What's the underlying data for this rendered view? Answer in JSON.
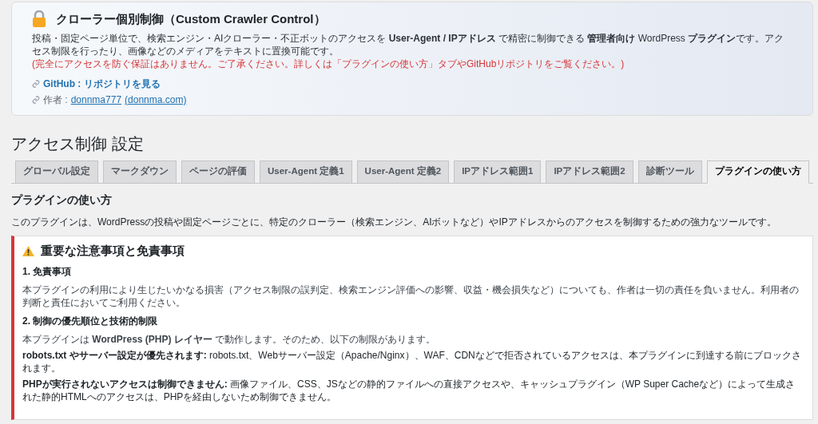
{
  "header": {
    "title": "クローラー個別制御（Custom Crawler Control）",
    "description": "投稿・固定ページ単位で、検索エンジン・AIクローラー・不正ボットのアクセスを **User-Agent / IPアドレス** で精密に制御できる **管理者向け** WordPress **プラグイン**です。アクセス制限を行ったり、画像などのメディアをテキストに置換可能です。",
    "warning": "(完全にアクセスを防ぐ保証はありません。ご了承ください。詳しくは「プラグインの使い方」タブやGitHubリポジトリをご覧ください。)",
    "github_link": "GitHub : リポジトリを見る",
    "author_label": "作者 :",
    "author_link": "donnma777",
    "author_site": "(donnma.com)"
  },
  "page_title": "アクセス制御 設定",
  "tabs": [
    {
      "label": "グローバル設定",
      "selected": false
    },
    {
      "label": "マークダウン",
      "selected": false
    },
    {
      "label": "ページの評価",
      "selected": false
    },
    {
      "label": "User-Agent 定義1",
      "selected": false
    },
    {
      "label": "User-Agent 定義2",
      "selected": false
    },
    {
      "label": "IPアドレス範囲1",
      "selected": false
    },
    {
      "label": "IPアドレス範囲2",
      "selected": false
    },
    {
      "label": "診断ツール",
      "selected": false
    },
    {
      "label": "プラグインの使い方",
      "selected": true
    }
  ],
  "section": {
    "title": "プラグインの使い方",
    "intro": "このプラグインは、WordPressの投稿や固定ページごとに、特定のクローラー（検索エンジン、AIボットなど）やIPアドレスからのアクセスを制御するための強力なツールです。"
  },
  "notice": {
    "title": "重要な注意事項と免責事項",
    "blocks": [
      {
        "kind": "heading",
        "text": "1. 免責事項"
      },
      {
        "kind": "paragraph",
        "text": "本プラグインの利用により生じたいかなる損害（アクセス制限の誤判定、検索エンジン評価への影響、収益・機会損失など）についても、作者は一切の責任を負いません。利用者の判断と責任においてご利用ください。"
      },
      {
        "kind": "heading",
        "text": "2. 制御の優先順位と技術的制限"
      },
      {
        "kind": "paragraph",
        "text": "本プラグインは **WordPress (PHP) レイヤー** で動作します。そのため、以下の制限があります。"
      },
      {
        "kind": "item",
        "text": "**robots.txt やサーバー設定が優先されます:** robots.txt、Webサーバー設定（Apache/Nginx）、WAF、CDNなどで拒否されているアクセスは、本プラグインに到達する前にブロックされます。"
      },
      {
        "kind": "item",
        "text": "**PHPが実行されないアクセスは制御できません:** 画像ファイル、CSS、JSなどの静的ファイルへの直接アクセスや、キャッシュプラグイン（WP Super Cacheなど）によって生成された静的HTMLへのアクセスは、PHPを経由しないため制御できません。"
      }
    ]
  }
}
